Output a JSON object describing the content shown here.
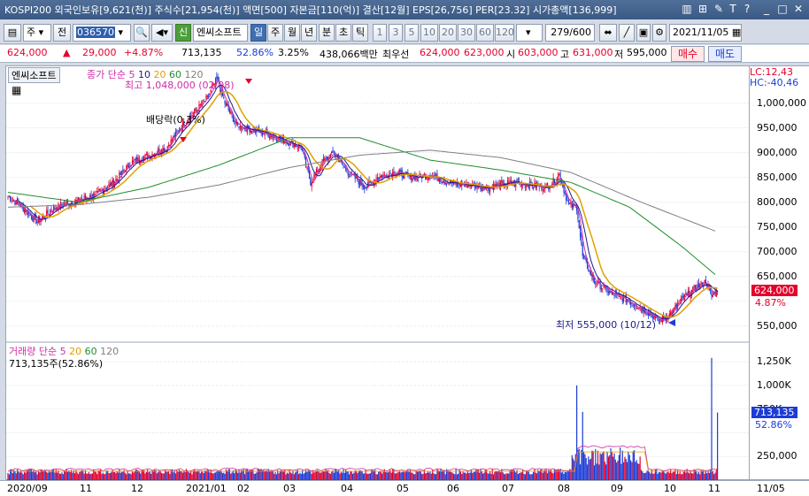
{
  "title_bar": {
    "text": "KOSPI200 외국인보유[9,621(천)] 주식수[21,954(천)] 액면[500] 자본금[110(억)] 결산[12월] EPS[26,756] PER[23.32] 시가총액[136,999]"
  },
  "toolbar": {
    "period_select": "주",
    "mode_label": "전",
    "code_input": "036570",
    "green_button": "신",
    "stock_name": "엔씨소프트",
    "period_tabs": [
      "일",
      "주",
      "월",
      "년",
      "분",
      "초",
      "틱"
    ],
    "interval_buttons": [
      "1",
      "3",
      "5",
      "10",
      "20",
      "30",
      "60",
      "120"
    ],
    "count_display": "279/600",
    "date_input": "2021/11/05"
  },
  "quote": {
    "price": "624,000",
    "change_arrow": "▲",
    "change": "29,000",
    "change_pct": "+4.87%",
    "volume": "713,135",
    "volume_ratio": "52.86%",
    "turnover": "3.25%",
    "trade_amount": "438,066백만",
    "priority_label": "최우선",
    "ask": "624,000",
    "bid": "623,000",
    "open_label": "시",
    "open": "603,000",
    "high_label": "고",
    "high": "631,000",
    "low_label": "저",
    "low": "595,000",
    "buy_label": "매수",
    "sell_label": "매도"
  },
  "price_panel": {
    "name_tag": "엔씨소프트",
    "legend": [
      "종가",
      "단순",
      "5",
      "10",
      "20",
      "60",
      "120"
    ],
    "high_annotation": "최고 1,048,000 (02/08)",
    "low_annotation": "최저 555,000 (10/12)",
    "dividend_annotation": "배당락(0.3%)",
    "lc": "LC:12,43",
    "hc": "HC:-40,46",
    "price_tag": "624,000",
    "change_tag": "4.87%"
  },
  "volume_panel": {
    "legend": [
      "거래량",
      "단순",
      "5",
      "20",
      "60",
      "120"
    ],
    "value_text": "713,135주(52.86%)",
    "value_tag": "713,135",
    "pct_tag": "52.86%"
  },
  "colors": {
    "up": "#e4002b",
    "down": "#1c3cd6",
    "ma5": "#cc2ea8",
    "ma10": "#1a1a8c",
    "ma20": "#e0a000",
    "ma60": "#1f8f2f",
    "ma120": "#808080"
  },
  "chart_data": {
    "type": "candlestick",
    "price_axis": {
      "ticks": [
        "1,000,000",
        "950,000",
        "900,000",
        "850,000",
        "800,000",
        "750,000",
        "700,000",
        "650,000",
        "550,000"
      ],
      "range": [
        530000,
        1060000
      ]
    },
    "volume_axis": {
      "ticks": [
        "1,250K",
        "1,000K",
        "750K",
        "250,000"
      ],
      "range": [
        0,
        1400000
      ]
    },
    "x_labels": [
      "2020/09",
      "11",
      "12",
      "2021/01",
      "02",
      "03",
      "04",
      "05",
      "06",
      "07",
      "08",
      "09",
      "10",
      "11",
      "11/05"
    ],
    "close_points": [
      [
        0,
        812000
      ],
      [
        12,
        790000
      ],
      [
        25,
        760000
      ],
      [
        40,
        790000
      ],
      [
        55,
        800000
      ],
      [
        75,
        815000
      ],
      [
        90,
        840000
      ],
      [
        105,
        880000
      ],
      [
        120,
        895000
      ],
      [
        135,
        910000
      ],
      [
        150,
        960000
      ],
      [
        160,
        985000
      ],
      [
        170,
        1010000
      ],
      [
        178,
        1048000
      ],
      [
        185,
        1000000
      ],
      [
        195,
        955000
      ],
      [
        210,
        945000
      ],
      [
        225,
        935000
      ],
      [
        240,
        920000
      ],
      [
        250,
        910000
      ],
      [
        258,
        840000
      ],
      [
        268,
        880000
      ],
      [
        278,
        900000
      ],
      [
        290,
        860000
      ],
      [
        305,
        830000
      ],
      [
        315,
        850000
      ],
      [
        330,
        860000
      ],
      [
        345,
        850000
      ],
      [
        360,
        855000
      ],
      [
        375,
        840000
      ],
      [
        390,
        835000
      ],
      [
        410,
        830000
      ],
      [
        430,
        840000
      ],
      [
        445,
        835000
      ],
      [
        460,
        830000
      ],
      [
        470,
        855000
      ],
      [
        478,
        795000
      ],
      [
        485,
        790000
      ],
      [
        490,
        690000
      ],
      [
        500,
        640000
      ],
      [
        515,
        615000
      ],
      [
        530,
        600000
      ],
      [
        545,
        580000
      ],
      [
        555,
        560000
      ],
      [
        565,
        575000
      ],
      [
        575,
        605000
      ],
      [
        585,
        625000
      ],
      [
        595,
        640000
      ],
      [
        600,
        610000
      ],
      [
        605,
        624000
      ]
    ],
    "ma60_points": [
      [
        0,
        820000
      ],
      [
        60,
        800000
      ],
      [
        120,
        830000
      ],
      [
        180,
        875000
      ],
      [
        240,
        930000
      ],
      [
        300,
        930000
      ],
      [
        360,
        885000
      ],
      [
        420,
        865000
      ],
      [
        480,
        840000
      ],
      [
        530,
        790000
      ],
      [
        575,
        710000
      ],
      [
        605,
        650000
      ]
    ],
    "ma120_points": [
      [
        0,
        790000
      ],
      [
        60,
        795000
      ],
      [
        120,
        810000
      ],
      [
        180,
        835000
      ],
      [
        240,
        870000
      ],
      [
        300,
        895000
      ],
      [
        360,
        905000
      ],
      [
        420,
        890000
      ],
      [
        480,
        860000
      ],
      [
        540,
        800000
      ],
      [
        605,
        740000
      ]
    ],
    "volume_spikes": [
      [
        485,
        1000000
      ],
      [
        490,
        720000
      ],
      [
        503,
        310000
      ],
      [
        600,
        1290000
      ],
      [
        605,
        713135
      ]
    ]
  }
}
